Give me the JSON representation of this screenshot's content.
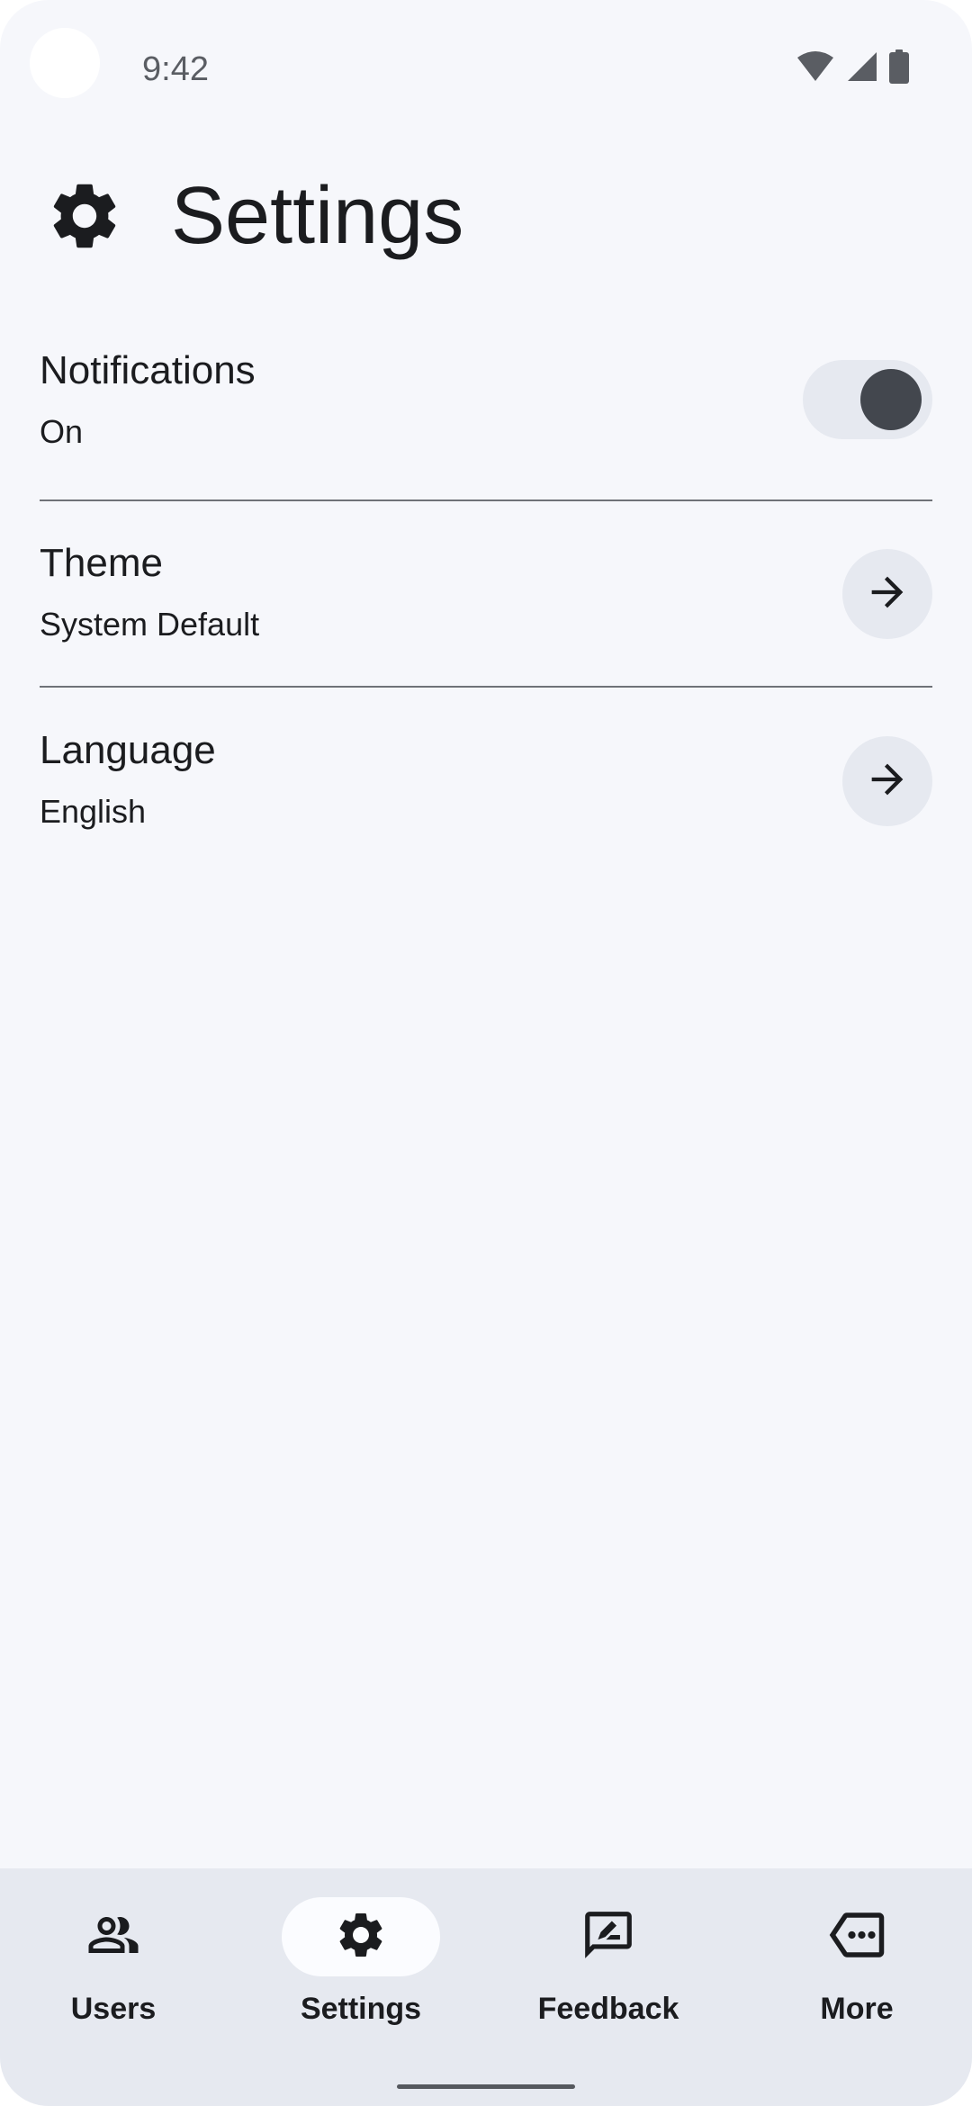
{
  "status_bar": {
    "time": "9:42",
    "icons": [
      "wifi-icon",
      "cellular-signal-icon",
      "battery-icon"
    ]
  },
  "header": {
    "icon": "gear-icon",
    "title": "Settings"
  },
  "settings": {
    "notifications": {
      "title": "Notifications",
      "value": "On",
      "toggle_on": true
    },
    "theme": {
      "title": "Theme",
      "value": "System Default",
      "action_icon": "arrow-right-icon"
    },
    "language": {
      "title": "Language",
      "value": "English",
      "action_icon": "arrow-right-icon"
    }
  },
  "bottom_nav": {
    "items": [
      {
        "label": "Users",
        "icon": "users-icon",
        "active": false
      },
      {
        "label": "Settings",
        "icon": "gear-icon",
        "active": true
      },
      {
        "label": "Feedback",
        "icon": "feedback-icon",
        "active": false
      },
      {
        "label": "More",
        "icon": "more-icon",
        "active": false
      }
    ]
  },
  "colors": {
    "background": "#f6f7fb",
    "surface_variant": "#e6e9f0",
    "on_surface": "#1b1c1f",
    "toggle_knob": "#43474e"
  }
}
